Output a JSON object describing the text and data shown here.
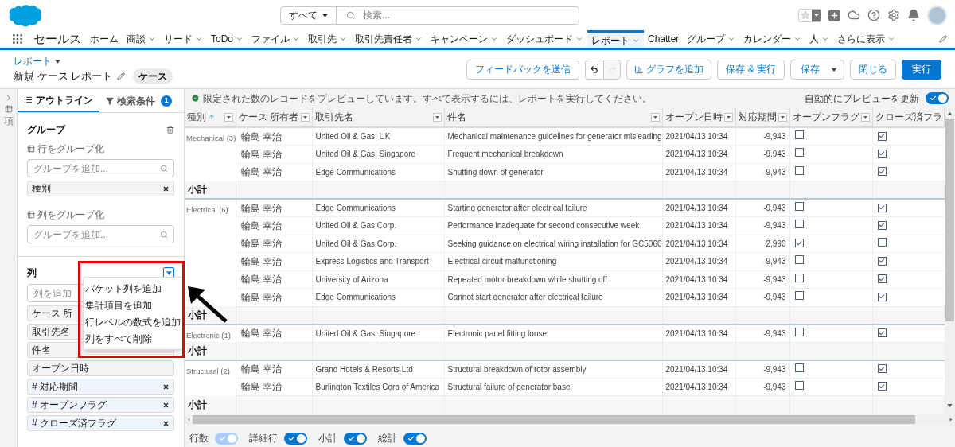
{
  "header": {
    "search": {
      "scope": "すべて",
      "placeholder": "検索..."
    }
  },
  "nav": {
    "app_name": "セールス",
    "tabs": [
      {
        "label": "ホーム",
        "menu": false,
        "selected": false
      },
      {
        "label": "商談",
        "menu": true,
        "selected": false
      },
      {
        "label": "リード",
        "menu": true,
        "selected": false
      },
      {
        "label": "ToDo",
        "menu": true,
        "selected": false
      },
      {
        "label": "ファイル",
        "menu": true,
        "selected": false
      },
      {
        "label": "取引先",
        "menu": true,
        "selected": false
      },
      {
        "label": "取引先責任者",
        "menu": true,
        "selected": false
      },
      {
        "label": "キャンペーン",
        "menu": true,
        "selected": false
      },
      {
        "label": "ダッシュボード",
        "menu": true,
        "selected": false
      },
      {
        "label": "レポート",
        "menu": true,
        "selected": true
      },
      {
        "label": "Chatter",
        "menu": false,
        "selected": false
      },
      {
        "label": "グループ",
        "menu": true,
        "selected": false
      },
      {
        "label": "カレンダー",
        "menu": true,
        "selected": false
      },
      {
        "label": "人",
        "menu": true,
        "selected": false
      },
      {
        "label": "さらに表示",
        "menu": true,
        "selected": false
      }
    ]
  },
  "page": {
    "breadcrumb": "レポート",
    "title": "新規 ケース レポート",
    "badge": "ケース",
    "buttons": [
      {
        "kind": "outline",
        "label": "フィードバックを送信"
      },
      {
        "kind": "undo",
        "disabled": false
      },
      {
        "kind": "redo",
        "disabled": true
      },
      {
        "kind": "chart",
        "label": "グラフを追加"
      },
      {
        "kind": "outline",
        "label": "保存 & 実行"
      },
      {
        "kind": "split",
        "label": "保存"
      },
      {
        "kind": "outline",
        "label": "閉じる"
      },
      {
        "kind": "brand",
        "label": "実行"
      }
    ]
  },
  "side_strip": {
    "label": "項"
  },
  "outline": {
    "tabs": [
      {
        "label": "アウトライン",
        "selected": true
      },
      {
        "label": "検索条件",
        "selected": false,
        "count": "1"
      }
    ],
    "groups": {
      "title": "グループ",
      "row_group": {
        "label": "行をグループ化",
        "placeholder": "グループを追加...",
        "items": [
          "種別"
        ]
      },
      "column_group": {
        "label": "列をグループ化",
        "placeholder": "グループを追加..."
      }
    },
    "columns": {
      "title": "列",
      "placeholder": "列を追加",
      "items": [
        {
          "label": "ケース 所",
          "kind": "text"
        },
        {
          "label": "取引先名",
          "kind": "text"
        },
        {
          "label": "件名",
          "kind": "text"
        },
        {
          "label": "オープン日時",
          "kind": "text"
        },
        {
          "label": "対応期間",
          "kind": "number",
          "symbol": "#"
        },
        {
          "label": "オープンフラグ",
          "kind": "number",
          "symbol": "#"
        },
        {
          "label": "クローズ済フラグ",
          "kind": "number",
          "symbol": "#"
        }
      ],
      "menu": [
        "バケット列を追加",
        "集計項目を追加",
        "行レベルの数式を追加",
        "列をすべて削除"
      ]
    }
  },
  "preview": {
    "message": "限定された数のレコードをプレビューしています。すべて表示するには、レポートを実行してください。",
    "auto_update": {
      "label": "自動的にプレビューを更新",
      "on": true
    }
  },
  "table": {
    "columns": [
      {
        "label": "種別",
        "sorted": true
      },
      {
        "label": "ケース 所有者",
        "sorted": false
      },
      {
        "label": "取引先名",
        "sorted": false
      },
      {
        "label": "件名",
        "sorted": false
      },
      {
        "label": "オープン日時",
        "sorted": false
      },
      {
        "label": "対応期間",
        "sorted": false
      },
      {
        "label": "オープンフラグ",
        "sorted": false
      },
      {
        "label": "クローズ済フラ",
        "sorted": false
      }
    ],
    "groups": [
      {
        "group": "Mechanical (3)",
        "subtotal": "小計",
        "rows": [
          {
            "owner": "輪島 幸治",
            "account": "United Oil & Gas, UK",
            "subject": "Mechanical maintenance guidelines for generator misleading",
            "opened": "2021/04/13 10:34",
            "days": "-9,943",
            "open_flag": false,
            "closed_flag": true
          },
          {
            "owner": "輪島 幸治",
            "account": "United Oil & Gas, Singapore",
            "subject": "Frequent mechanical breakdown",
            "opened": "2021/04/13 10:34",
            "days": "-9,943",
            "open_flag": false,
            "closed_flag": true
          },
          {
            "owner": "輪島 幸治",
            "account": "Edge Communications",
            "subject": "Shutting down of generator",
            "opened": "2021/04/13 10:34",
            "days": "-9,943",
            "open_flag": false,
            "closed_flag": true
          }
        ]
      },
      {
        "group": "Electrical (6)",
        "subtotal": "小計",
        "rows": [
          {
            "owner": "輪島 幸治",
            "account": "Edge Communications",
            "subject": "Starting generator after electrical failure",
            "opened": "2021/04/13 10:34",
            "days": "-9,943",
            "open_flag": false,
            "closed_flag": true
          },
          {
            "owner": "輪島 幸治",
            "account": "United Oil & Gas Corp.",
            "subject": "Performance inadequate for second consecutive week",
            "opened": "2021/04/13 10:34",
            "days": "-9,943",
            "open_flag": false,
            "closed_flag": true
          },
          {
            "owner": "輪島 幸治",
            "account": "United Oil & Gas Corp.",
            "subject": "Seeking guidance on electrical wiring installation for GC5060",
            "opened": "2021/04/13 10:34",
            "days": "2,990",
            "open_flag": true,
            "closed_flag": false
          },
          {
            "owner": "輪島 幸治",
            "account": "Express Logistics and Transport",
            "subject": "Electrical circuit malfunctioning",
            "opened": "2021/04/13 10:34",
            "days": "-9,943",
            "open_flag": false,
            "closed_flag": true
          },
          {
            "owner": "輪島 幸治",
            "account": "University of Arizona",
            "subject": "Repeated motor breakdown while shutting off",
            "opened": "2021/04/13 10:34",
            "days": "-9,943",
            "open_flag": false,
            "closed_flag": true
          },
          {
            "owner": "輪島 幸治",
            "account": "Edge Communications",
            "subject": "Cannot start generator after electrical failure",
            "opened": "2021/04/13 10:34",
            "days": "-9,943",
            "open_flag": false,
            "closed_flag": true
          }
        ]
      },
      {
        "group": "Electronic (1)",
        "subtotal": "小計",
        "rows": [
          {
            "owner": "輪島 幸治",
            "account": "United Oil & Gas, Singapore",
            "subject": "Electronic panel fitting loose",
            "opened": "2021/04/13 10:34",
            "days": "-9,943",
            "open_flag": false,
            "closed_flag": true
          }
        ]
      },
      {
        "group": "Structural (2)",
        "subtotal": "小計",
        "rows": [
          {
            "owner": "輪島 幸治",
            "account": "Grand Hotels & Resorts Ltd",
            "subject": "Structural breakdown of rotor assembly",
            "opened": "2021/04/13 10:34",
            "days": "-9,943",
            "open_flag": false,
            "closed_flag": true
          },
          {
            "owner": "輪島 幸治",
            "account": "Burlington Textiles Corp of America",
            "subject": "Structural failure of generator base",
            "opened": "2021/04/13 10:34",
            "days": "-9,943",
            "open_flag": false,
            "closed_flag": true
          }
        ]
      }
    ]
  },
  "footer": {
    "toggles": [
      {
        "label": "行数",
        "on": true,
        "disabled": true
      },
      {
        "label": "詳細行",
        "on": true,
        "disabled": false
      },
      {
        "label": "小計",
        "on": true,
        "disabled": false
      },
      {
        "label": "総計",
        "on": true,
        "disabled": false
      }
    ]
  }
}
